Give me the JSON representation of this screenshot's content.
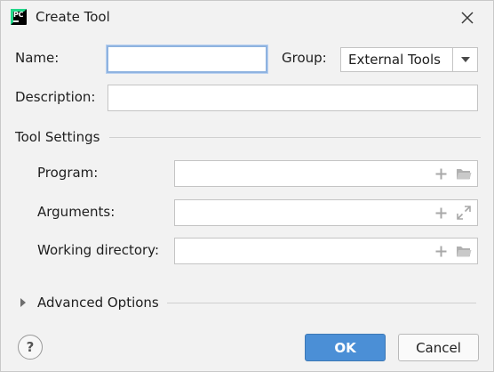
{
  "window": {
    "title": "Create Tool",
    "app_icon": "pycharm-logo",
    "app_icon_letters": "PC"
  },
  "form": {
    "name_label": "Name:",
    "name_value": "",
    "group_label": "Group:",
    "group_value": "External Tools",
    "description_label": "Description:",
    "description_value": ""
  },
  "tool_settings": {
    "header": "Tool Settings",
    "program_label": "Program:",
    "program_value": "",
    "arguments_label": "Arguments:",
    "arguments_value": "",
    "working_dir_label": "Working directory:",
    "working_dir_value": ""
  },
  "advanced": {
    "label": "Advanced Options",
    "expanded": false
  },
  "buttons": {
    "help_label": "?",
    "ok_label": "OK",
    "cancel_label": "Cancel"
  },
  "colors": {
    "accent": "#4b8fd6",
    "focus_border": "#8fb3e0",
    "background": "#f2f2f2"
  }
}
